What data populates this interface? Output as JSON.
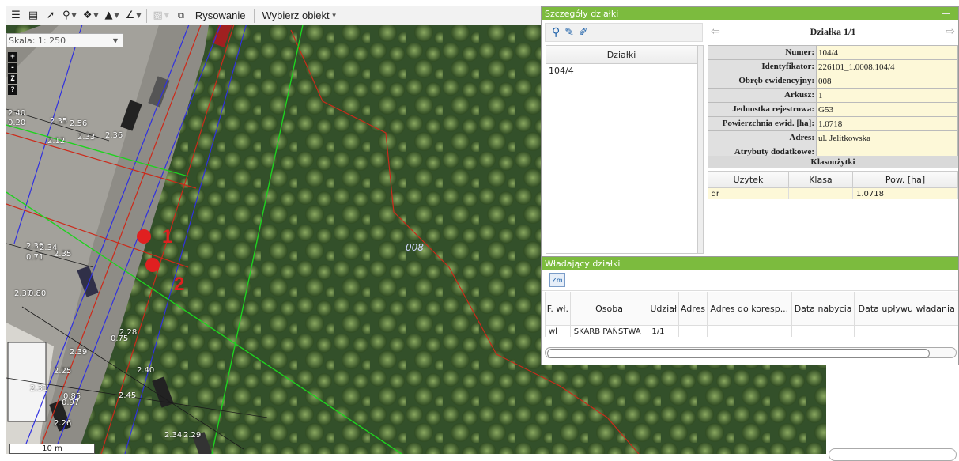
{
  "map": {
    "scale_label": "Skala: 1: 250",
    "scalebar_label": "10 m",
    "zoom_buttons": [
      "+",
      "-",
      "Z",
      "?"
    ],
    "markers": [
      "1",
      "2"
    ],
    "parcel_label": "008",
    "labels": [
      "2.40",
      "0.20",
      "2.35",
      "2.56",
      "2.33",
      "2.36",
      "2.12",
      "2.39",
      "2.34",
      "2.35",
      "0.71",
      "2.37",
      "0.80",
      "0.75",
      "2.28",
      "2.39",
      "2.40",
      "2.25",
      "2.31",
      "2.45",
      "2.26",
      "2.34",
      "2.29",
      "0.85",
      "0.97"
    ],
    "colors": {
      "marker": "#e02020",
      "parcel_line": "#cc2a1a",
      "green_line": "#1fd21f",
      "blue_line": "#3030e0"
    }
  },
  "toolbar": {
    "icons": [
      "layers-icon",
      "list-icon",
      "pointer-icon",
      "search-icon",
      "info-icon",
      "measure-icon",
      "angle-icon",
      "disabled-icon",
      "copy-icon"
    ],
    "drawing_label": "Rysowanie",
    "select_label": "Wybierz obiekt"
  },
  "details": {
    "title": "Szczegóły działki",
    "plot_title": "Działka 1/1",
    "list_header": "Działki",
    "list_items": [
      "104/4"
    ],
    "attributes": [
      {
        "key": "Numer:",
        "value": "104/4"
      },
      {
        "key": "Identyfikator:",
        "value": "226101_1.0008.104/4"
      },
      {
        "key": "Obręb ewidencyjny:",
        "value": "008"
      },
      {
        "key": "Arkusz:",
        "value": "1"
      },
      {
        "key": "Jednostka rejestrowa:",
        "value": "G53"
      },
      {
        "key": "Powierzchnia ewid. [ha]:",
        "value": "1.0718"
      },
      {
        "key": "Adres:",
        "value": "ul. Jelitkowska"
      },
      {
        "key": "Atrybuty dodatkowe:",
        "value": ""
      }
    ],
    "klasouzytki_title": "Klasoużytki",
    "klas_headers": [
      "Użytek",
      "Klasa",
      "Pow. [ha]"
    ],
    "klas_rows": [
      [
        "dr",
        "",
        "1.0718"
      ]
    ]
  },
  "owners": {
    "title": "Władający działki",
    "zm_label": "Zm",
    "headers": [
      "F. wł.",
      "Osoba",
      "Udział",
      "Adres",
      "Adres do koresp...",
      "Data nabycia",
      "Data upływu władania"
    ],
    "rows": [
      [
        "wl",
        "SKARB PAŃSTWA",
        "1/1",
        "",
        "",
        "",
        ""
      ]
    ]
  }
}
